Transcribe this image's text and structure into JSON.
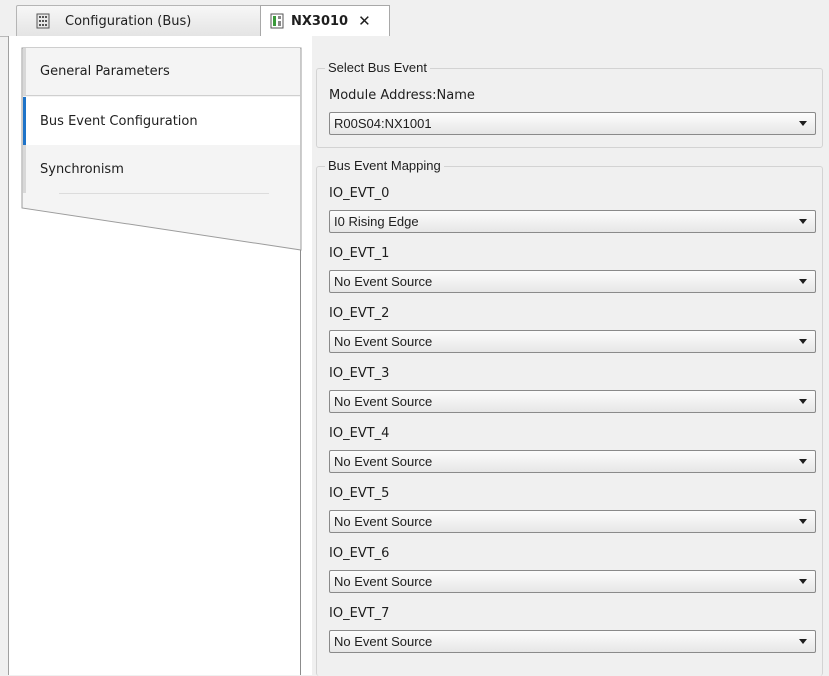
{
  "tabs": [
    {
      "label": "Configuration (Bus)",
      "icon": "bus-config-icon",
      "active": false
    },
    {
      "label": "NX3010",
      "icon": "module-icon",
      "active": true
    }
  ],
  "left_nav": {
    "items": [
      {
        "label": "General Parameters",
        "selected": false
      },
      {
        "label": "Bus Event Configuration",
        "selected": true
      },
      {
        "label": "Synchronism",
        "selected": false
      }
    ]
  },
  "select_bus_event": {
    "title": "Select Bus Event",
    "module_label": "Module Address:Name",
    "module_value": "R00S04:NX1001"
  },
  "mapping": {
    "title": "Bus Event Mapping",
    "events": [
      {
        "label": "IO_EVT_0",
        "value": "I0 Rising Edge"
      },
      {
        "label": "IO_EVT_1",
        "value": "No Event Source"
      },
      {
        "label": "IO_EVT_2",
        "value": "No Event Source"
      },
      {
        "label": "IO_EVT_3",
        "value": "No Event Source"
      },
      {
        "label": "IO_EVT_4",
        "value": "No Event Source"
      },
      {
        "label": "IO_EVT_5",
        "value": "No Event Source"
      },
      {
        "label": "IO_EVT_6",
        "value": "No Event Source"
      },
      {
        "label": "IO_EVT_7",
        "value": "No Event Source"
      }
    ]
  },
  "colors": {
    "accent": "#1e73c8",
    "background": "#f0f0f0"
  }
}
